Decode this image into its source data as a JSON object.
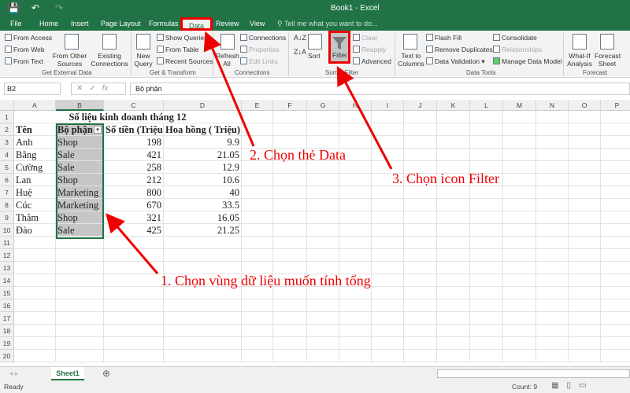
{
  "window": {
    "title": "Book1 - Excel"
  },
  "tabs": [
    "File",
    "Home",
    "Insert",
    "Page Layout",
    "Formulas",
    "Data",
    "Review",
    "View"
  ],
  "tell_me": "Tell me what you want to do...",
  "ribbon": {
    "get_external": {
      "items": [
        "From Access",
        "From Web",
        "From Text"
      ],
      "from_other": "From Other Sources",
      "existing": "Existing Connections",
      "label": "Get External Data"
    },
    "get_transform": {
      "new_query": "New Query",
      "items": [
        "Show Queries",
        "From Table",
        "Recent Sources"
      ],
      "label": "Get & Transform"
    },
    "connections": {
      "refresh": "Refresh All",
      "items": [
        "Connections",
        "Properties",
        "Edit Links"
      ],
      "label": "Connections"
    },
    "sort_filter": {
      "sort": "Sort",
      "filter": "Filter",
      "items": [
        "Clear",
        "Reapply",
        "Advanced"
      ],
      "label": "Sort & Filter"
    },
    "data_tools": {
      "text_to_columns": "Text to Columns",
      "items": [
        "Flash Fill",
        "Remove Duplicates",
        "Data Validation",
        "Consolidate",
        "Relationships",
        "Manage Data Model"
      ],
      "label": "Data Tools"
    },
    "forecast": {
      "what_if": "What-If Analysis",
      "forecast_sheet": "Forecast Sheet",
      "label": "Forecast"
    }
  },
  "formula_bar": {
    "name_box": "B2",
    "fx": "fx",
    "value": "Bộ phận"
  },
  "columns": [
    "A",
    "B",
    "C",
    "D",
    "E",
    "F",
    "G",
    "H",
    "I",
    "J",
    "K",
    "L",
    "M",
    "N",
    "O",
    "P"
  ],
  "sheet": {
    "title": "Số liệu kinh doanh tháng 12",
    "headers": [
      "Tên",
      "Bộ phận",
      "Số tiền (Triệu",
      "Hoa hồng ( Triệu)"
    ],
    "rows": [
      [
        "Anh",
        "Shop",
        "198",
        "9.9"
      ],
      [
        "Bằng",
        "Sale",
        "421",
        "21.05"
      ],
      [
        "Cường",
        "Sale",
        "258",
        "12.9"
      ],
      [
        "Lan",
        "Shop",
        "212",
        "10.6"
      ],
      [
        "Huệ",
        "Marketing",
        "800",
        "40"
      ],
      [
        "Cúc",
        "Marketing",
        "670",
        "33.5"
      ],
      [
        "Thắm",
        "Shop",
        "321",
        "16.05"
      ],
      [
        "Đào",
        "Sale",
        "425",
        "21.25"
      ]
    ]
  },
  "sheet_tab": "Sheet1",
  "status": {
    "ready": "Ready",
    "count": "Count: 9"
  },
  "annotations": {
    "step1": "1. Chọn vùng dữ liệu muốn tính tổng",
    "step2": "2. Chọn thẻ Data",
    "step3": "3. Chọn icon Filter"
  },
  "colors": {
    "excel_green": "#217346",
    "annotation_red": "#e00000"
  }
}
